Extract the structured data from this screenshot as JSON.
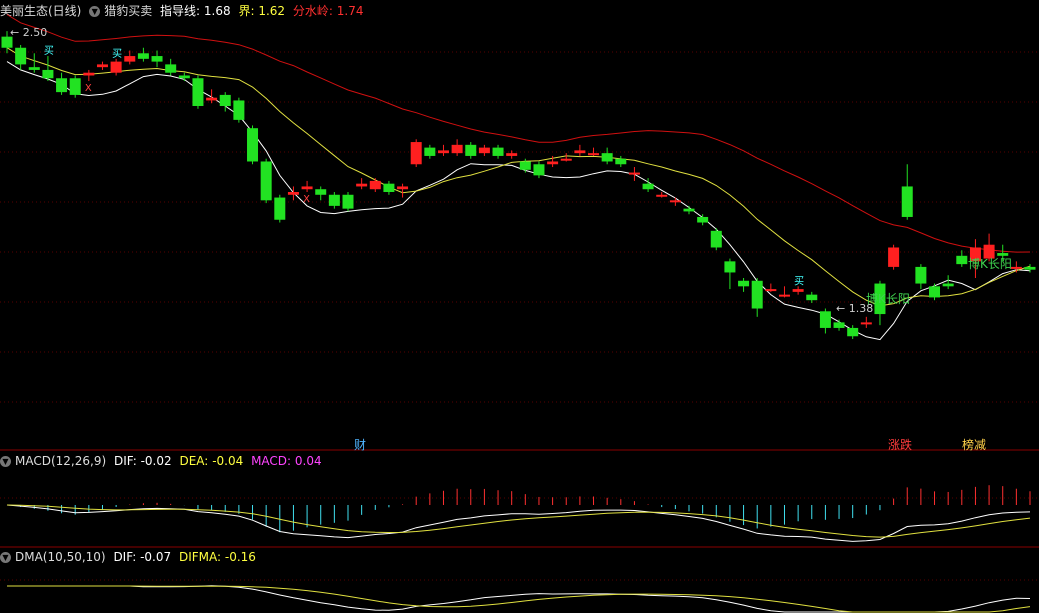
{
  "header": {
    "stock_name": "美丽生态(日线)",
    "indicator_name": "猎豹买卖",
    "guide_label": "指导线:",
    "guide_value": "1.68",
    "bound_label": "界:",
    "bound_value": "1.62",
    "watershed_label": "分水岭:",
    "watershed_value": "1.74"
  },
  "price_labels": {
    "high": "2.50",
    "low": "1.38"
  },
  "events": [
    {
      "label": "财",
      "color": "#4fb4ff"
    },
    {
      "label": "涨跌",
      "color": "#ff3c3c"
    },
    {
      "label": "榜减",
      "color": "#ffd24a"
    }
  ],
  "annotations": [
    "博K长阳",
    "博K长阳"
  ],
  "markers": {
    "buy": "买",
    "sell": "X"
  },
  "macd": {
    "label": "MACD(12,26,9)",
    "dif_label": "DIF:",
    "dif_value": "-0.02",
    "dea_label": "DEA:",
    "dea_value": "-0.04",
    "macd_label": "MACD:",
    "macd_value": "0.04"
  },
  "dma": {
    "label": "DMA(10,50,10)",
    "dif_label": "DIF:",
    "dif_value": "-0.07",
    "difma_label": "DIFMA:",
    "difma_value": "-0.16"
  },
  "colors": {
    "up": "#ff2020",
    "down": "#22e222",
    "grid": "#5a0000",
    "ma_short": "#ffffff",
    "ma_mid": "#e0e040",
    "ma_long": "#d01010",
    "macd_pos": "#ff3030",
    "macd_neg": "#40e0f0",
    "macd_text": "#ff44ff"
  },
  "chart_data": {
    "type": "candlestick",
    "candles": [
      [
        2.49,
        2.45,
        2.51,
        2.43
      ],
      [
        2.45,
        2.39,
        2.46,
        2.37
      ],
      [
        2.38,
        2.37,
        2.43,
        2.36
      ],
      [
        2.37,
        2.34,
        2.42,
        2.33
      ],
      [
        2.34,
        2.29,
        2.36,
        2.28
      ],
      [
        2.34,
        2.28,
        2.35,
        2.27
      ],
      [
        2.35,
        2.36,
        2.37,
        2.33
      ],
      [
        2.38,
        2.39,
        2.4,
        2.37
      ],
      [
        2.36,
        2.4,
        2.41,
        2.35
      ],
      [
        2.4,
        2.42,
        2.44,
        2.39
      ],
      [
        2.43,
        2.41,
        2.45,
        2.4
      ],
      [
        2.42,
        2.4,
        2.44,
        2.38
      ],
      [
        2.39,
        2.36,
        2.41,
        2.35
      ],
      [
        2.35,
        2.34,
        2.36,
        2.33
      ],
      [
        2.34,
        2.24,
        2.35,
        2.23
      ],
      [
        2.26,
        2.27,
        2.3,
        2.25
      ],
      [
        2.28,
        2.24,
        2.29,
        2.22
      ],
      [
        2.26,
        2.19,
        2.27,
        2.18
      ],
      [
        2.16,
        2.04,
        2.17,
        2.03
      ],
      [
        2.04,
        1.9,
        2.05,
        1.89
      ],
      [
        1.91,
        1.83,
        1.92,
        1.82
      ],
      [
        1.92,
        1.93,
        1.95,
        1.9
      ],
      [
        1.94,
        1.95,
        1.97,
        1.93
      ],
      [
        1.94,
        1.92,
        1.95,
        1.9
      ],
      [
        1.92,
        1.88,
        1.93,
        1.87
      ],
      [
        1.92,
        1.87,
        1.93,
        1.86
      ],
      [
        1.95,
        1.96,
        1.98,
        1.94
      ],
      [
        1.94,
        1.97,
        1.98,
        1.93
      ],
      [
        1.96,
        1.93,
        1.97,
        1.92
      ],
      [
        1.94,
        1.95,
        1.96,
        1.91
      ],
      [
        2.03,
        2.11,
        2.12,
        2.02
      ],
      [
        2.09,
        2.06,
        2.1,
        2.05
      ],
      [
        2.07,
        2.08,
        2.1,
        2.06
      ],
      [
        2.07,
        2.1,
        2.12,
        2.06
      ],
      [
        2.1,
        2.06,
        2.11,
        2.05
      ],
      [
        2.07,
        2.09,
        2.1,
        2.06
      ],
      [
        2.09,
        2.06,
        2.1,
        2.05
      ],
      [
        2.06,
        2.07,
        2.08,
        2.05
      ],
      [
        2.04,
        2.01,
        2.05,
        2.0
      ],
      [
        2.03,
        1.99,
        2.04,
        1.98
      ],
      [
        2.03,
        2.04,
        2.06,
        2.02
      ],
      [
        2.05,
        2.05,
        2.07,
        2.04
      ],
      [
        2.07,
        2.08,
        2.1,
        2.06
      ],
      [
        2.07,
        2.07,
        2.09,
        2.06
      ],
      [
        2.07,
        2.04,
        2.09,
        2.03
      ],
      [
        2.05,
        2.03,
        2.06,
        2.02
      ],
      [
        2.0,
        2.0,
        2.02,
        1.97
      ],
      [
        1.96,
        1.94,
        1.98,
        1.93
      ],
      [
        1.92,
        1.92,
        1.93,
        1.91
      ],
      [
        1.9,
        1.9,
        1.91,
        1.88
      ],
      [
        1.87,
        1.86,
        1.88,
        1.85
      ],
      [
        1.84,
        1.82,
        1.85,
        1.81
      ],
      [
        1.79,
        1.73,
        1.8,
        1.72
      ],
      [
        1.68,
        1.64,
        1.69,
        1.58
      ],
      [
        1.61,
        1.59,
        1.62,
        1.57
      ],
      [
        1.61,
        1.51,
        1.62,
        1.48
      ],
      [
        1.58,
        1.58,
        1.6,
        1.57
      ],
      [
        1.56,
        1.56,
        1.59,
        1.55
      ],
      [
        1.57,
        1.58,
        1.59,
        1.56
      ],
      [
        1.56,
        1.54,
        1.57,
        1.53
      ],
      [
        1.5,
        1.44,
        1.51,
        1.42
      ],
      [
        1.46,
        1.44,
        1.47,
        1.43
      ],
      [
        1.44,
        1.41,
        1.45,
        1.4
      ],
      [
        1.46,
        1.46,
        1.48,
        1.44
      ],
      [
        1.6,
        1.49,
        1.61,
        1.45
      ],
      [
        1.66,
        1.73,
        1.74,
        1.65
      ],
      [
        1.95,
        1.84,
        2.03,
        1.83
      ],
      [
        1.66,
        1.6,
        1.67,
        1.58
      ],
      [
        1.59,
        1.55,
        1.6,
        1.54
      ],
      [
        1.6,
        1.59,
        1.63,
        1.58
      ],
      [
        1.7,
        1.67,
        1.72,
        1.66
      ],
      [
        1.68,
        1.73,
        1.76,
        1.62
      ],
      [
        1.69,
        1.74,
        1.78,
        1.68
      ],
      [
        1.71,
        1.7,
        1.74,
        1.68
      ],
      [
        1.66,
        1.66,
        1.68,
        1.64
      ],
      [
        1.66,
        1.65,
        1.67,
        1.64
      ]
    ],
    "ylim": [
      1.0,
      2.55
    ]
  }
}
